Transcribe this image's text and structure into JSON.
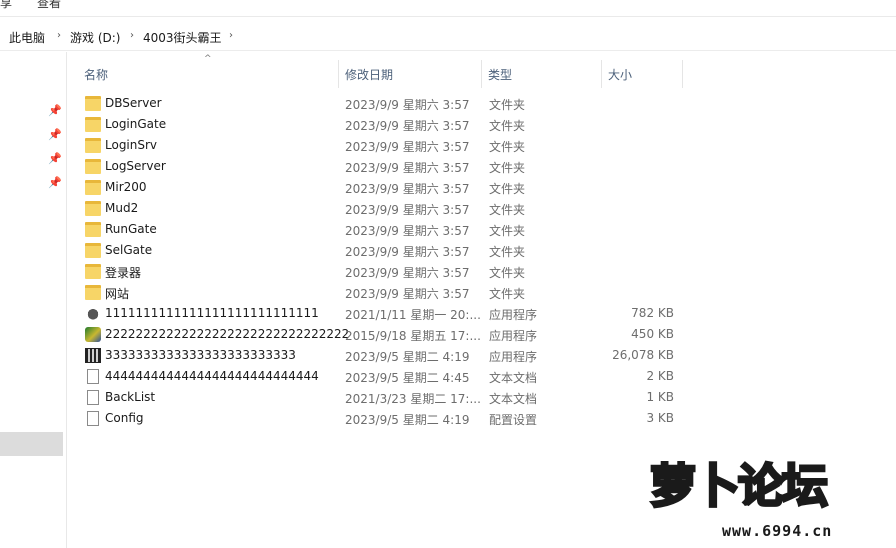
{
  "top_menu": {
    "item1": "享",
    "item2": "查看"
  },
  "address_bar": {
    "crumbs": [
      "此电脑",
      "游戏 (D:)",
      "4003街头霸王"
    ]
  },
  "columns": {
    "name": "名称",
    "date": "修改日期",
    "type": "类型",
    "size": "大小"
  },
  "files": [
    {
      "name": "DBServer",
      "date": "2023/9/9 星期六 3:57",
      "type": "文件夹",
      "size": "",
      "icon": "folder-icon"
    },
    {
      "name": "LoginGate",
      "date": "2023/9/9 星期六 3:57",
      "type": "文件夹",
      "size": "",
      "icon": "folder-icon"
    },
    {
      "name": "LoginSrv",
      "date": "2023/9/9 星期六 3:57",
      "type": "文件夹",
      "size": "",
      "icon": "folder-icon"
    },
    {
      "name": "LogServer",
      "date": "2023/9/9 星期六 3:57",
      "type": "文件夹",
      "size": "",
      "icon": "folder-icon"
    },
    {
      "name": "Mir200",
      "date": "2023/9/9 星期六 3:57",
      "type": "文件夹",
      "size": "",
      "icon": "folder-icon"
    },
    {
      "name": "Mud2",
      "date": "2023/9/9 星期六 3:57",
      "type": "文件夹",
      "size": "",
      "icon": "folder-icon"
    },
    {
      "name": "RunGate",
      "date": "2023/9/9 星期六 3:57",
      "type": "文件夹",
      "size": "",
      "icon": "folder-icon"
    },
    {
      "name": "SelGate",
      "date": "2023/9/9 星期六 3:57",
      "type": "文件夹",
      "size": "",
      "icon": "folder-icon"
    },
    {
      "name": "登录器",
      "date": "2023/9/9 星期六 3:57",
      "type": "文件夹",
      "size": "",
      "icon": "folder-icon"
    },
    {
      "name": "网站",
      "date": "2023/9/9 星期六 3:57",
      "type": "文件夹",
      "size": "",
      "icon": "folder-icon"
    },
    {
      "name": "1111111111111111111111111111",
      "date": "2021/1/11 星期一 20:...",
      "type": "应用程序",
      "size": "782 KB",
      "icon": "app-icon"
    },
    {
      "name": "22222222222222222222222222222222",
      "date": "2015/9/18 星期五 17:...",
      "type": "应用程序",
      "size": "450 KB",
      "icon": "app-icon"
    },
    {
      "name": "3333333333333333333333333",
      "date": "2023/9/5 星期二 4:19",
      "type": "应用程序",
      "size": "26,078 KB",
      "icon": "app-icon"
    },
    {
      "name": "4444444444444444444444444444",
      "date": "2023/9/5 星期二 4:45",
      "type": "文本文档",
      "size": "2 KB",
      "icon": "text-file-icon"
    },
    {
      "name": "BackList",
      "date": "2021/3/23 星期二 17:...",
      "type": "文本文档",
      "size": "1 KB",
      "icon": "text-file-icon"
    },
    {
      "name": "Config",
      "date": "2023/9/5 星期二 4:19",
      "type": "配置设置",
      "size": "3 KB",
      "icon": "config-file-icon"
    }
  ],
  "watermark": {
    "brand": "萝卜论坛",
    "url": "www.6994.cn"
  }
}
